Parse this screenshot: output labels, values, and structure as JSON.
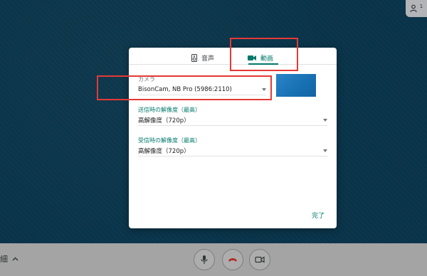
{
  "header": {
    "people_count": "1"
  },
  "dialog": {
    "tabs": [
      {
        "label": "音声",
        "icon": "speaker-icon"
      },
      {
        "label": "動画",
        "icon": "videocam-icon"
      }
    ],
    "camera": {
      "label": "カメラ",
      "value": "BisonCam, NB Pro (5986:2110)"
    },
    "send_resolution": {
      "label": "送信時の解像度（最高）",
      "value": "高解像度（720p）"
    },
    "receive_resolution": {
      "label": "受信時の解像度（最高）",
      "value": "高解像度（720p）"
    },
    "done_label": "完了"
  },
  "bottom": {
    "details_label": "細"
  },
  "colors": {
    "accent": "#00796b",
    "highlight": "#e53935",
    "hangup": "#d93025"
  }
}
